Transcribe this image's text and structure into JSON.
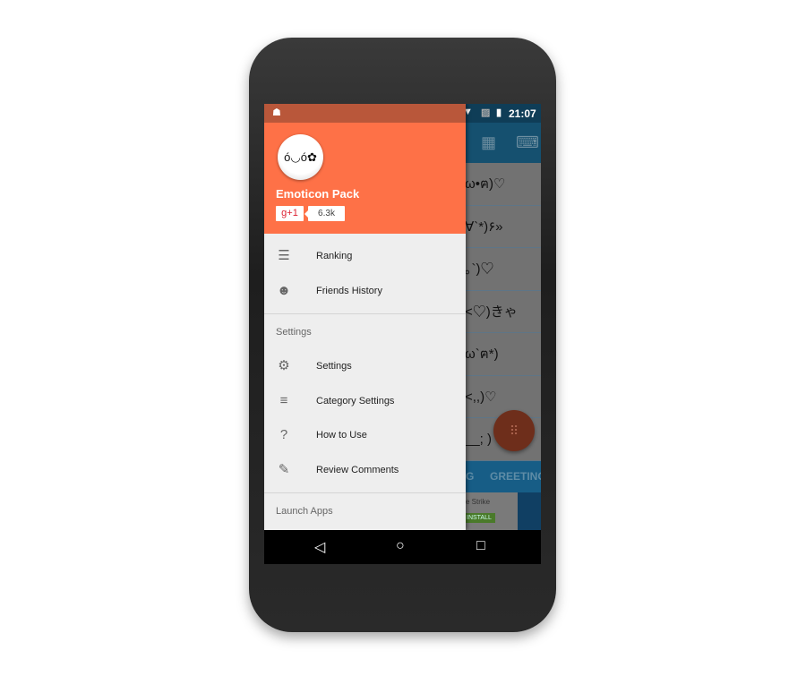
{
  "status_bar": {
    "time": "21:07",
    "notification_icon": "android-icon",
    "icons": [
      "wifi-icon",
      "no-sim-icon",
      "battery-charging-icon"
    ]
  },
  "background": {
    "toolbar_icons": [
      "grid-icon",
      "keyboard-icon"
    ],
    "rows": [
      "ω•ฅ)♡",
      "∀`*)۶»",
      "｡`)♡",
      "<♡)きゃ",
      "ω`ฅ*)",
      "<,,)♡",
      "__; )"
    ],
    "tabs": [
      "G",
      "GREETING"
    ],
    "ad": {
      "text": "e Strike",
      "button": "INSTALL"
    },
    "fab_icon": "dialpad-icon"
  },
  "drawer": {
    "avatar_face": "ó◡ó✿",
    "app_name": "Emoticon Pack",
    "gplus_label": "g+1",
    "gplus_count": "6.3k",
    "items_top": [
      {
        "label": "Ranking",
        "icon": "ranked-list-icon"
      },
      {
        "label": "Friends History",
        "icon": "face-icon"
      }
    ],
    "settings_section": "Settings",
    "settings_items": [
      {
        "label": "Settings",
        "icon": "gear-icon"
      },
      {
        "label": "Category Settings",
        "icon": "playlist-add-icon"
      },
      {
        "label": "How to Use",
        "icon": "help-icon"
      },
      {
        "label": "Review Comments",
        "icon": "rate-review-icon"
      }
    ],
    "launch_section": "Launch Apps"
  },
  "colors": {
    "accent": "#fe7147",
    "toolbar": "#2a8ccc",
    "drawer_bg": "#eeeeee"
  }
}
